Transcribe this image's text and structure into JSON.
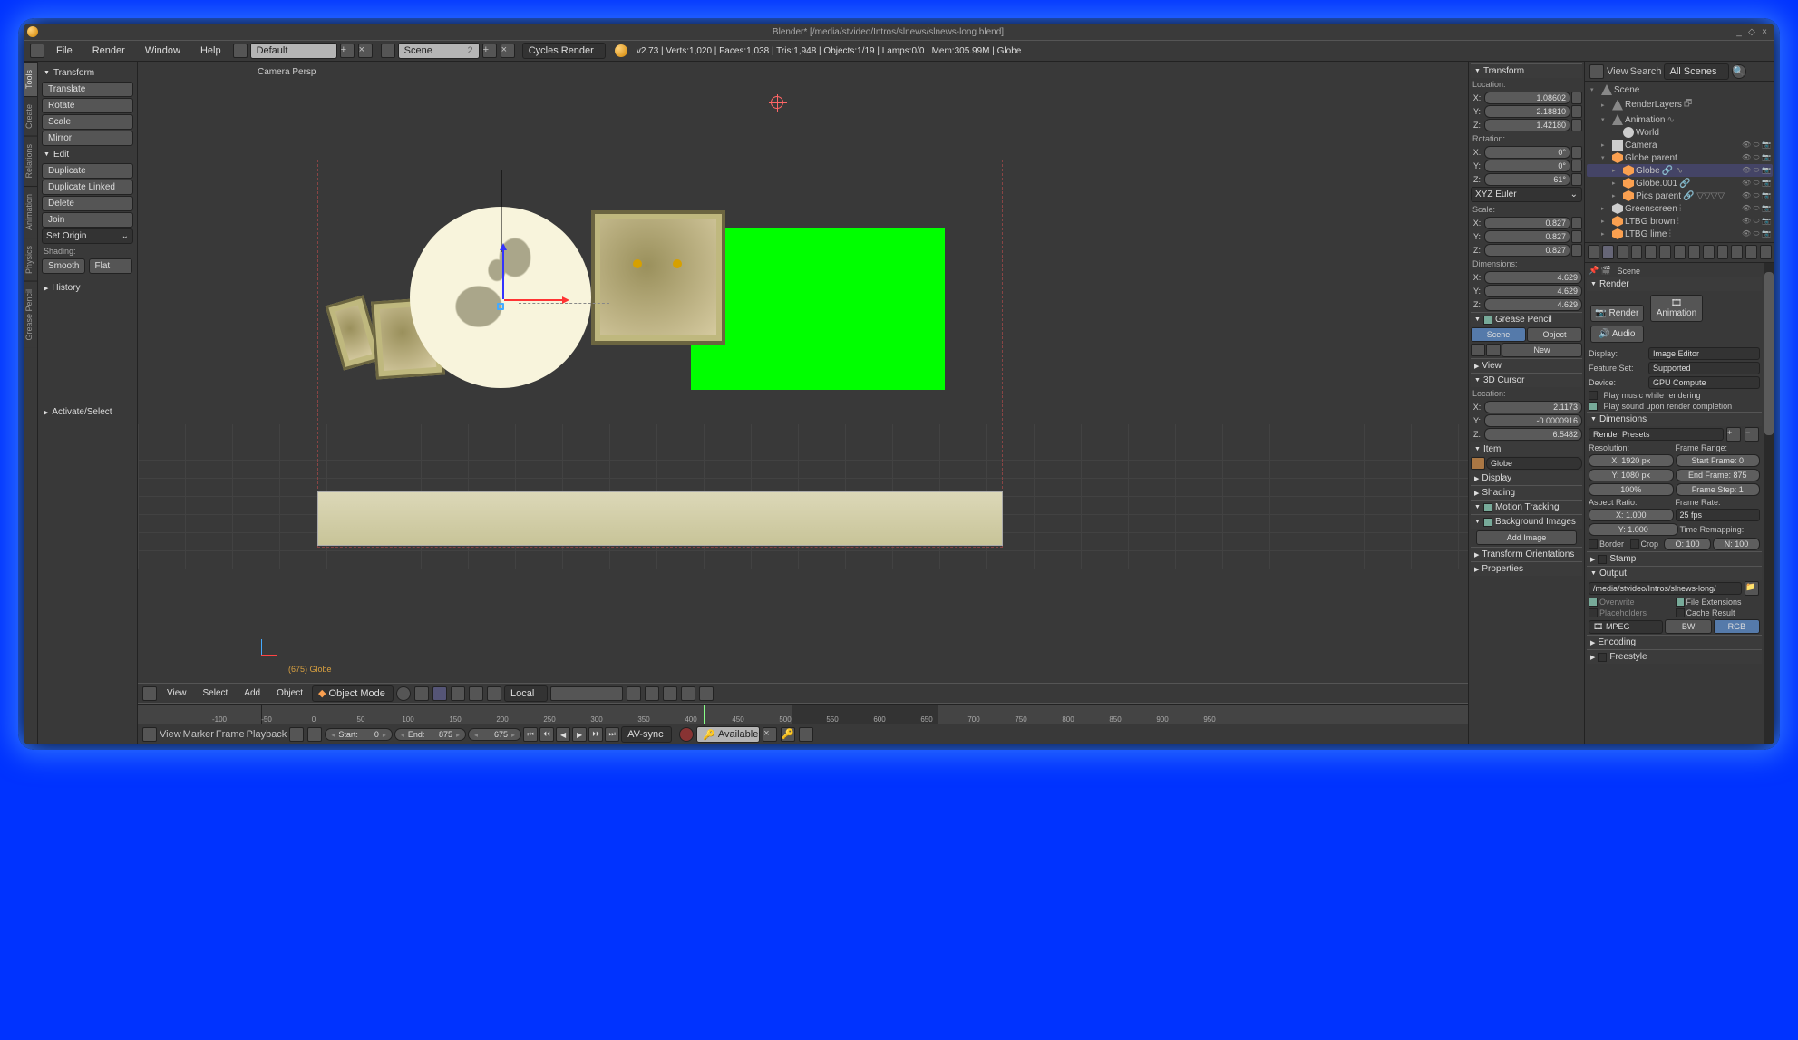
{
  "title": "Blender* [/media/stvideo/Intros/slnews/slnews-long.blend]",
  "header": {
    "menus": [
      "File",
      "Render",
      "Window",
      "Help"
    ],
    "layout": "Default",
    "scene": "Scene",
    "sceneUsers": "2",
    "engine": "Cycles Render",
    "stats": "v2.73 | Verts:1,020 | Faces:1,038 | Tris:1,948 | Objects:1/19 | Lamps:0/0 | Mem:305.99M | Globe"
  },
  "toolshelf": {
    "tabs": [
      "Tools",
      "Create",
      "Relations",
      "Animation",
      "Physics",
      "Grease Pencil"
    ],
    "transform": "Transform",
    "translate": "Translate",
    "rotate": "Rotate",
    "scale": "Scale",
    "mirror": "Mirror",
    "edit": "Edit",
    "duplicate": "Duplicate",
    "dupLinked": "Duplicate Linked",
    "delete": "Delete",
    "join": "Join",
    "setOrigin": "Set Origin",
    "shading": "Shading:",
    "smooth": "Smooth",
    "flat": "Flat",
    "history": "History",
    "lastOp": "Activate/Select"
  },
  "view3d": {
    "persp": "Camera Persp",
    "frameLabel": "(675) Globe",
    "menus": [
      "View",
      "Select",
      "Add",
      "Object"
    ],
    "mode": "Object Mode",
    "orient": "Local"
  },
  "npanel": {
    "transform": "Transform",
    "loc": "Location:",
    "rot": "Rotation:",
    "sca": "Scale:",
    "dim": "Dimensions:",
    "locX": "1.08602",
    "locY": "2.18810",
    "locZ": "1.42180",
    "rotX": "0°",
    "rotY": "0°",
    "rotZ": "61°",
    "rotMode": "XYZ Euler",
    "scaX": "0.827",
    "scaY": "0.827",
    "scaZ": "0.827",
    "dimX": "4.629",
    "dimY": "4.629",
    "dimZ": "4.629",
    "gp": "Grease Pencil",
    "gpScene": "Scene",
    "gpObject": "Object",
    "gpNew": "New",
    "view": "View",
    "cursor": "3D Cursor",
    "cloc": "Location:",
    "cX": "2.1173",
    "cY": "-0.0000916",
    "cZ": "6.5482",
    "item": "Item",
    "itemName": "Globe",
    "display": "Display",
    "shadingP": "Shading",
    "mtrack": "Motion Tracking",
    "bgimg": "Background Images",
    "addImg": "Add Image",
    "torient": "Transform Orientations",
    "propsP": "Properties"
  },
  "outliner": {
    "view": "View",
    "search": "Search",
    "filter": "All Scenes",
    "tree": [
      {
        "d": 0,
        "t": "▾",
        "ic": "scene",
        "n": "Scene"
      },
      {
        "d": 1,
        "t": "▸",
        "ic": "scene",
        "n": "RenderLayers",
        "extra": "🗗"
      },
      {
        "d": 1,
        "t": "▾",
        "ic": "scene",
        "n": "Animation",
        "extra": "∿"
      },
      {
        "d": 2,
        "t": "",
        "ic": "lamp",
        "n": "World"
      },
      {
        "d": 1,
        "t": "▸",
        "ic": "cam",
        "n": "Camera",
        "r": true,
        "eye": true
      },
      {
        "d": 1,
        "t": "▾",
        "ic": "obj",
        "n": "Globe parent",
        "r": true
      },
      {
        "d": 2,
        "t": "▸",
        "ic": "obj",
        "n": "Globe",
        "sel": true,
        "r": true,
        "extra": "🔗 ∿"
      },
      {
        "d": 2,
        "t": "▸",
        "ic": "obj",
        "n": "Globe.001",
        "r": true,
        "extra": "🔗"
      },
      {
        "d": 2,
        "t": "▸",
        "ic": "obj",
        "n": "Pics parent",
        "r": true,
        "extra": "🔗 ▽▽▽▽"
      },
      {
        "d": 1,
        "t": "▸",
        "ic": "mesh",
        "n": "Greenscreen",
        "r": true,
        "extra": "⫶"
      },
      {
        "d": 1,
        "t": "▸",
        "ic": "obj",
        "n": "LTBG brown",
        "r": true,
        "extra": "⫶"
      },
      {
        "d": 1,
        "t": "▸",
        "ic": "obj",
        "n": "LTBG lime",
        "r": true,
        "extra": "⫶"
      }
    ]
  },
  "props": {
    "crumb": "Scene",
    "render": "Render",
    "btnRender": "Render",
    "btnAnim": "Animation",
    "btnAudio": "Audio",
    "display": "Display:",
    "displayV": "Image Editor",
    "feat": "Feature Set:",
    "featV": "Supported",
    "device": "Device:",
    "deviceV": "GPU Compute",
    "playMusic": "Play music while rendering",
    "playSound": "Play sound upon render completion",
    "dims": "Dimensions",
    "preset": "Render Presets",
    "res": "Resolution:",
    "frange": "Frame Range:",
    "resX": "X:        1920 px",
    "resY": "Y:        1080 px",
    "resP": "100%",
    "fstart": "Start Frame:       0",
    "fend": "End Frame:     875",
    "fstep": "Frame Step:       1",
    "aspect": "Aspect Ratio:",
    "frate": "Frame Rate:",
    "aspX": "X:         1.000",
    "aspY": "Y:         1.000",
    "fps": "25 fps",
    "tremap": "Time Remapping:",
    "border": "Border",
    "crop": "Crop",
    "old": "O: 100",
    "new": "N: 100",
    "stamp": "Stamp",
    "output": "Output",
    "outPath": "/media/stvideo/Intros/slnews-long/",
    "overwrite": "Overwrite",
    "fext": "File Extensions",
    "placeh": "Placeholders",
    "cache": "Cache Result",
    "format": "MPEG",
    "bw": "BW",
    "rgb": "RGB",
    "encoding": "Encoding",
    "freestyle": "Freestyle"
  },
  "timeline": {
    "menus": [
      "View",
      "Marker",
      "Frame",
      "Playback"
    ],
    "start": "Start:",
    "startV": "0",
    "end": "End:",
    "endV": "875",
    "cur": "675",
    "sync": "AV-sync",
    "activeKeying": "Available",
    "marks": [
      "-100",
      "-50",
      "0",
      "50",
      "100",
      "150",
      "200",
      "250",
      "300",
      "350",
      "400",
      "450",
      "500",
      "550",
      "600",
      "650",
      "700",
      "750",
      "800",
      "850",
      "900",
      "950"
    ]
  }
}
